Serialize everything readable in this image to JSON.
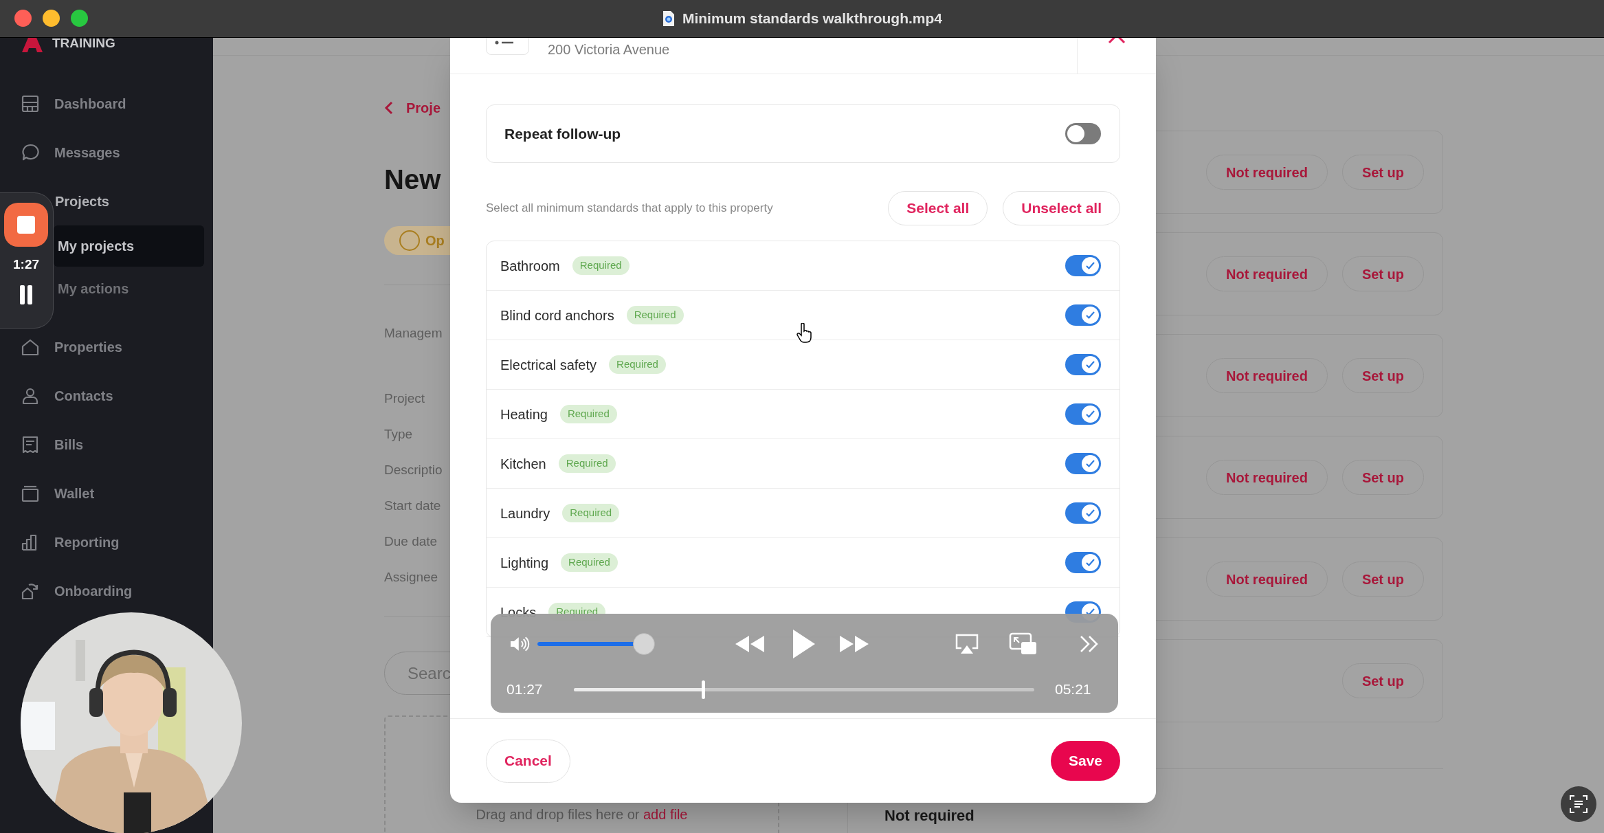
{
  "window": {
    "title": "Minimum standards walkthrough.mp4"
  },
  "recorder": {
    "elapsed": "1:27"
  },
  "sidebar": {
    "brand": "TRAINING",
    "items": [
      {
        "label": "Dashboard",
        "selected": false
      },
      {
        "label": "Messages",
        "selected": false
      },
      {
        "label": "Projects",
        "selected": false,
        "children": [
          {
            "label": "My projects",
            "selected": true
          },
          {
            "label": "My actions",
            "selected": false
          }
        ]
      },
      {
        "label": "Properties",
        "selected": false
      },
      {
        "label": "Contacts",
        "selected": false
      },
      {
        "label": "Bills",
        "selected": false
      },
      {
        "label": "Wallet",
        "selected": false
      },
      {
        "label": "Reporting",
        "selected": false
      },
      {
        "label": "Onboarding",
        "selected": false
      }
    ]
  },
  "page": {
    "breadcrumb": "Proje",
    "heading": "New",
    "status": "Op",
    "section_label": "Managem",
    "fields": [
      "Project",
      "Type",
      "Descriptio",
      "Start date",
      "Due date",
      "Assignee"
    ],
    "search": {
      "placeholder": "Searc"
    },
    "dropzone": {
      "text": "Drag and drop files here or",
      "link": "add file"
    },
    "standard_cards": [
      {
        "buttons": [
          "Not required",
          "Set up"
        ]
      },
      {
        "buttons": [
          "Not required",
          "Set up"
        ]
      },
      {
        "buttons": [
          "Not required",
          "Set up"
        ]
      },
      {
        "buttons": [
          "Not required",
          "Set up"
        ]
      },
      {
        "buttons": [
          "Not required",
          "Set up"
        ]
      },
      {
        "buttons": [
          "Set up"
        ]
      }
    ],
    "bottom_label": "Not required"
  },
  "dialog": {
    "address": "200 Victoria Avenue",
    "repeat": {
      "label": "Repeat follow-up",
      "on": false
    },
    "instruction": "Select all minimum standards that apply to this property",
    "select_all": "Select all",
    "unselect_all": "Unselect all",
    "standards": [
      {
        "name": "Bathroom",
        "badge": "Required",
        "on": true
      },
      {
        "name": "Blind cord anchors",
        "badge": "Required",
        "on": true
      },
      {
        "name": "Electrical safety",
        "badge": "Required",
        "on": true
      },
      {
        "name": "Heating",
        "badge": "Required",
        "on": true
      },
      {
        "name": "Kitchen",
        "badge": "Required",
        "on": true
      },
      {
        "name": "Laundry",
        "badge": "Required",
        "on": true
      },
      {
        "name": "Lighting",
        "badge": "Required",
        "on": true
      },
      {
        "name": "Locks",
        "badge": "Required",
        "on": true
      }
    ],
    "cancel": "Cancel",
    "save": "Save"
  },
  "player": {
    "elapsed": "01:27",
    "duration": "05:21",
    "playing": false,
    "volume": {
      "level": 0.92
    },
    "progress": {
      "level": 0.28
    }
  }
}
